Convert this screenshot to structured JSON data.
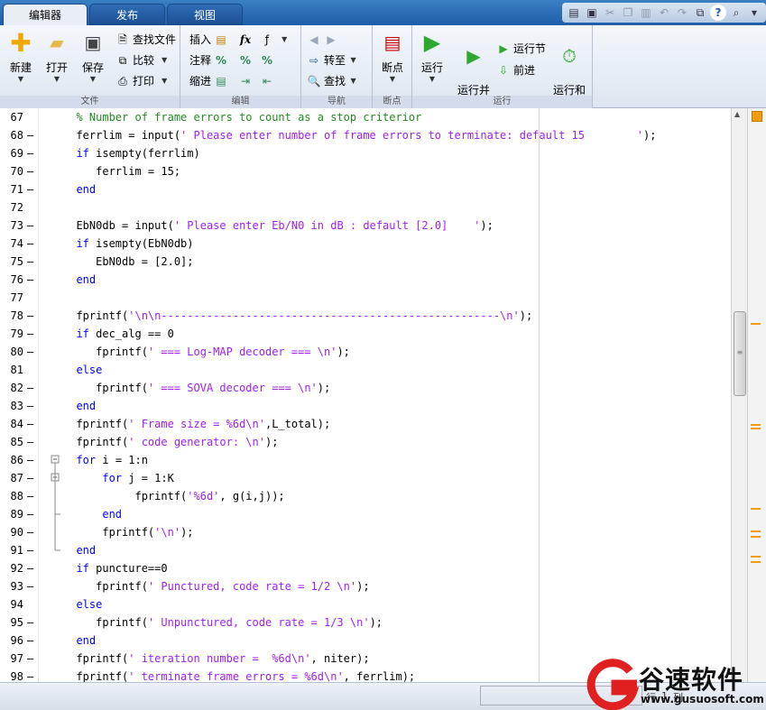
{
  "tabs": [
    {
      "label": "编辑器",
      "active": true
    },
    {
      "label": "发布",
      "active": false
    },
    {
      "label": "视图",
      "active": false
    }
  ],
  "quick_access": [
    {
      "name": "layout-icon",
      "glyph": "▤"
    },
    {
      "name": "save-icon",
      "glyph": "▣"
    },
    {
      "name": "cut-icon",
      "glyph": "✂",
      "disabled": true
    },
    {
      "name": "copy-icon",
      "glyph": "❐",
      "disabled": true
    },
    {
      "name": "paste-icon",
      "glyph": "▥",
      "disabled": true
    },
    {
      "name": "undo-icon",
      "glyph": "↶",
      "disabled": true
    },
    {
      "name": "redo-icon",
      "glyph": "↷",
      "disabled": true
    },
    {
      "name": "switch-windows-icon",
      "glyph": "⧉"
    },
    {
      "name": "help-icon",
      "glyph": "?"
    },
    {
      "name": "search-doc-icon",
      "glyph": "⌕"
    },
    {
      "name": "options-icon",
      "glyph": "▾"
    }
  ],
  "ribbon": {
    "file": {
      "section": "文件",
      "new": "新建",
      "open": "打开",
      "save": "保存",
      "find_files": "查找文件",
      "compare": "比较",
      "print": "打印"
    },
    "edit": {
      "section": "编辑",
      "insert": "插入",
      "comment": "注释",
      "indent": "缩进"
    },
    "navigate": {
      "section": "导航",
      "goto": "转至",
      "find": "查找"
    },
    "breakpoints": {
      "section": "断点",
      "label": "断点"
    },
    "run": {
      "section": "运行",
      "run": "运行",
      "run_and_advance": "运行并\n前进",
      "run_section": "运行节",
      "advance": "前进",
      "run_and_time": "运行和\n计时"
    }
  },
  "code_lines": [
    {
      "n": "67",
      "dash": false,
      "segs": [
        {
          "t": "  % Number of frame errors to count as a stop criterior",
          "c": "cmt"
        }
      ]
    },
    {
      "n": "68",
      "dash": true,
      "segs": [
        {
          "t": "  ferrlim = input(",
          "c": ""
        },
        {
          "t": "' Please enter number of frame errors to terminate: default 15        '",
          "c": "str"
        },
        {
          "t": ");",
          "c": ""
        }
      ]
    },
    {
      "n": "69",
      "dash": true,
      "segs": [
        {
          "t": "  ",
          "c": ""
        },
        {
          "t": "if",
          "c": "kw"
        },
        {
          "t": " isempty(ferrlim)",
          "c": ""
        }
      ]
    },
    {
      "n": "70",
      "dash": true,
      "segs": [
        {
          "t": "     ferrlim = 15;",
          "c": ""
        }
      ]
    },
    {
      "n": "71",
      "dash": true,
      "segs": [
        {
          "t": "  ",
          "c": ""
        },
        {
          "t": "end",
          "c": "kw"
        }
      ]
    },
    {
      "n": "72",
      "dash": false,
      "segs": [
        {
          "t": "",
          "c": ""
        }
      ]
    },
    {
      "n": "73",
      "dash": true,
      "segs": [
        {
          "t": "  EbN0db = input(",
          "c": ""
        },
        {
          "t": "' Please enter Eb/N0 in dB : default [2.0]    '",
          "c": "str"
        },
        {
          "t": ");",
          "c": ""
        }
      ]
    },
    {
      "n": "74",
      "dash": true,
      "segs": [
        {
          "t": "  ",
          "c": ""
        },
        {
          "t": "if",
          "c": "kw"
        },
        {
          "t": " isempty(EbN0db)",
          "c": ""
        }
      ]
    },
    {
      "n": "75",
      "dash": true,
      "segs": [
        {
          "t": "     EbN0db = [2.0];",
          "c": ""
        }
      ]
    },
    {
      "n": "76",
      "dash": true,
      "segs": [
        {
          "t": "  ",
          "c": ""
        },
        {
          "t": "end",
          "c": "kw"
        }
      ]
    },
    {
      "n": "77",
      "dash": false,
      "segs": [
        {
          "t": "",
          "c": ""
        }
      ]
    },
    {
      "n": "78",
      "dash": true,
      "segs": [
        {
          "t": "  fprintf(",
          "c": ""
        },
        {
          "t": "'\\n\\n----------------------------------------------------\\n'",
          "c": "str"
        },
        {
          "t": ");",
          "c": ""
        }
      ]
    },
    {
      "n": "79",
      "dash": true,
      "segs": [
        {
          "t": "  ",
          "c": ""
        },
        {
          "t": "if",
          "c": "kw"
        },
        {
          "t": " dec_alg == 0",
          "c": ""
        }
      ]
    },
    {
      "n": "80",
      "dash": true,
      "segs": [
        {
          "t": "     fprintf(",
          "c": ""
        },
        {
          "t": "' === Log-MAP decoder === \\n'",
          "c": "str"
        },
        {
          "t": ");",
          "c": ""
        }
      ]
    },
    {
      "n": "81",
      "dash": false,
      "segs": [
        {
          "t": "  ",
          "c": ""
        },
        {
          "t": "else",
          "c": "kw"
        }
      ]
    },
    {
      "n": "82",
      "dash": true,
      "segs": [
        {
          "t": "     fprintf(",
          "c": ""
        },
        {
          "t": "' === SOVA decoder === \\n'",
          "c": "str"
        },
        {
          "t": ");",
          "c": ""
        }
      ]
    },
    {
      "n": "83",
      "dash": true,
      "segs": [
        {
          "t": "  ",
          "c": ""
        },
        {
          "t": "end",
          "c": "kw"
        }
      ]
    },
    {
      "n": "84",
      "dash": true,
      "segs": [
        {
          "t": "  fprintf(",
          "c": ""
        },
        {
          "t": "' Frame size = %6d\\n'",
          "c": "str"
        },
        {
          "t": ",L_total);",
          "c": ""
        }
      ]
    },
    {
      "n": "85",
      "dash": true,
      "segs": [
        {
          "t": "  fprintf(",
          "c": ""
        },
        {
          "t": "' code generator: \\n'",
          "c": "str"
        },
        {
          "t": ");",
          "c": ""
        }
      ]
    },
    {
      "n": "86",
      "dash": true,
      "segs": [
        {
          "t": "  ",
          "c": ""
        },
        {
          "t": "for",
          "c": "kw"
        },
        {
          "t": " i = 1:n",
          "c": ""
        }
      ]
    },
    {
      "n": "87",
      "dash": true,
      "segs": [
        {
          "t": "      ",
          "c": ""
        },
        {
          "t": "for",
          "c": "kw"
        },
        {
          "t": " j = 1:K",
          "c": ""
        }
      ]
    },
    {
      "n": "88",
      "dash": true,
      "segs": [
        {
          "t": "           fprintf(",
          "c": ""
        },
        {
          "t": "'%6d'",
          "c": "str"
        },
        {
          "t": ", g(i,j));",
          "c": ""
        }
      ]
    },
    {
      "n": "89",
      "dash": true,
      "segs": [
        {
          "t": "      ",
          "c": ""
        },
        {
          "t": "end",
          "c": "kw"
        }
      ]
    },
    {
      "n": "90",
      "dash": true,
      "segs": [
        {
          "t": "      fprintf(",
          "c": ""
        },
        {
          "t": "'\\n'",
          "c": "str"
        },
        {
          "t": ");",
          "c": ""
        }
      ]
    },
    {
      "n": "91",
      "dash": true,
      "segs": [
        {
          "t": "  ",
          "c": ""
        },
        {
          "t": "end",
          "c": "kw"
        }
      ]
    },
    {
      "n": "92",
      "dash": true,
      "segs": [
        {
          "t": "  ",
          "c": ""
        },
        {
          "t": "if",
          "c": "kw"
        },
        {
          "t": " puncture==0",
          "c": ""
        }
      ]
    },
    {
      "n": "93",
      "dash": true,
      "segs": [
        {
          "t": "     fprintf(",
          "c": ""
        },
        {
          "t": "' Punctured, code rate = 1/2 \\n'",
          "c": "str"
        },
        {
          "t": ");",
          "c": ""
        }
      ]
    },
    {
      "n": "94",
      "dash": false,
      "segs": [
        {
          "t": "  ",
          "c": ""
        },
        {
          "t": "else",
          "c": "kw"
        }
      ]
    },
    {
      "n": "95",
      "dash": true,
      "segs": [
        {
          "t": "     fprintf(",
          "c": ""
        },
        {
          "t": "' Unpunctured, code rate = 1/3 \\n'",
          "c": "str"
        },
        {
          "t": ");",
          "c": ""
        }
      ]
    },
    {
      "n": "96",
      "dash": true,
      "segs": [
        {
          "t": "  ",
          "c": ""
        },
        {
          "t": "end",
          "c": "kw"
        }
      ]
    },
    {
      "n": "97",
      "dash": true,
      "segs": [
        {
          "t": "  fprintf(",
          "c": ""
        },
        {
          "t": "' iteration number =  %6d\\n'",
          "c": "str"
        },
        {
          "t": ", niter);",
          "c": ""
        }
      ]
    },
    {
      "n": "98",
      "dash": true,
      "segs": [
        {
          "t": "  fprintf(",
          "c": ""
        },
        {
          "t": "' terminate frame errors = %6d\\n'",
          "c": "str"
        },
        {
          "t": ", ferrlim);",
          "c": ""
        }
      ]
    }
  ],
  "status": {
    "row_label": "行",
    "row_value": "1",
    "col_label": "列"
  },
  "watermark": {
    "text": "谷速软件",
    "url": "www.gusuosoft.com"
  },
  "colors": {
    "comment": "#228b22",
    "string": "#a020f0",
    "keyword": "#0000ff",
    "warning": "#f39c12"
  }
}
